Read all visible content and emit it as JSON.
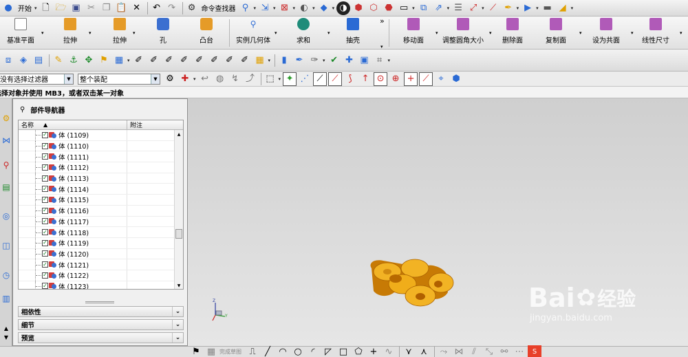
{
  "toolbar1": {
    "start_label": "开始",
    "command_finder_label": "命令查找器"
  },
  "ribbon": {
    "buttons": [
      {
        "label": "基准平面",
        "icon": "datum-plane-icon"
      },
      {
        "label": "拉伸",
        "icon": "extrude-icon"
      },
      {
        "label": "拉伸",
        "icon": "extrude-icon"
      },
      {
        "label": "孔",
        "icon": "hole-icon"
      },
      {
        "label": "凸台",
        "icon": "boss-icon"
      },
      {
        "label": "实例几何体",
        "icon": "instance-geometry-icon"
      },
      {
        "label": "求和",
        "icon": "unite-icon"
      },
      {
        "label": "抽壳",
        "icon": "shell-icon"
      },
      {
        "label": "移动面",
        "icon": "move-face-icon"
      },
      {
        "label": "调整圆角大小",
        "icon": "resize-blend-icon"
      },
      {
        "label": "删除面",
        "icon": "delete-face-icon"
      },
      {
        "label": "复制面",
        "icon": "copy-face-icon"
      },
      {
        "label": "设为共面",
        "icon": "make-coplanar-icon"
      },
      {
        "label": "线性尺寸",
        "icon": "linear-dimension-icon"
      }
    ],
    "overflow_label": "»"
  },
  "selection_bar": {
    "filter_value": "没有选择过滤器",
    "scope_value": "整个装配"
  },
  "status_text": "选择对象并使用 MB3，或者双击某一对象",
  "navigator": {
    "title": "部件导航器",
    "col_name": "名称",
    "col_note": "附注",
    "rows": [
      "体 (1109)",
      "体 (1110)",
      "体 (1111)",
      "体 (1112)",
      "体 (1113)",
      "体 (1114)",
      "体 (1115)",
      "体 (1116)",
      "体 (1117)",
      "体 (1118)",
      "体 (1119)",
      "体 (1120)",
      "体 (1121)",
      "体 (1122)",
      "体 (1123)"
    ],
    "panels": [
      "相依性",
      "细节",
      "预览"
    ]
  },
  "viewport": {
    "model_color": "#e8a010",
    "watermark_brand": "Bai",
    "watermark_cn": "经验",
    "watermark_url": "jingyan.baidu.com"
  },
  "bottom_bar": {
    "finish_sketch_label": "完成草图"
  },
  "colors": {
    "accent_blue": "#3b6fd0",
    "check_green": "#0a7a1a"
  }
}
